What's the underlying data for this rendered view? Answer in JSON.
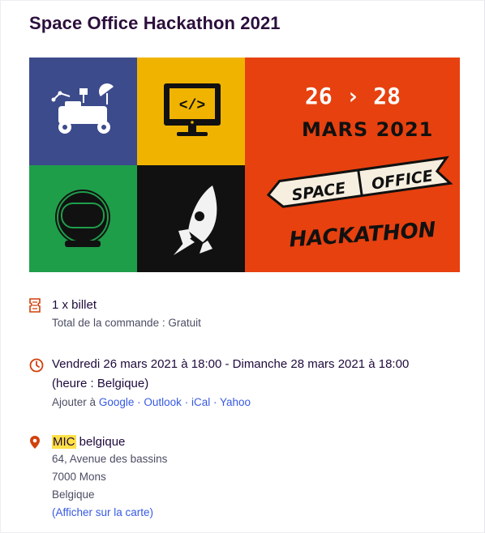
{
  "event": {
    "title": "Space Office Hackathon 2021"
  },
  "banner": {
    "date_range": "26 › 28",
    "month_year": "MARS 2021",
    "logo_word1": "SPACE",
    "logo_word2": "OFFICE",
    "logo_word3": "HACKATHON",
    "tile_colors": [
      "#3c4b8c",
      "#f0b400",
      "#1f9e4a",
      "#111111",
      "#e7410f"
    ]
  },
  "ticket": {
    "quantity_label": "1 x billet",
    "order_total": "Total de la commande : Gratuit"
  },
  "datetime": {
    "line1": "Vendredi 26 mars 2021 à 18:00 - Dimanche 28 mars 2021 à 18:00",
    "line2": "(heure : Belgique)",
    "add_to_label": "Ajouter à",
    "calendars": [
      "Google",
      "Outlook",
      "iCal",
      "Yahoo"
    ]
  },
  "location": {
    "name_highlight": "MIC",
    "name_rest": " belgique",
    "address1": "64, Avenue des bassins",
    "address2": "7000 Mons",
    "country": "Belgique",
    "map_link": "(Afficher sur la carte)"
  },
  "colors": {
    "accent_icon": "#d1410c",
    "link": "#3659e3",
    "highlight": "#ffe047"
  }
}
